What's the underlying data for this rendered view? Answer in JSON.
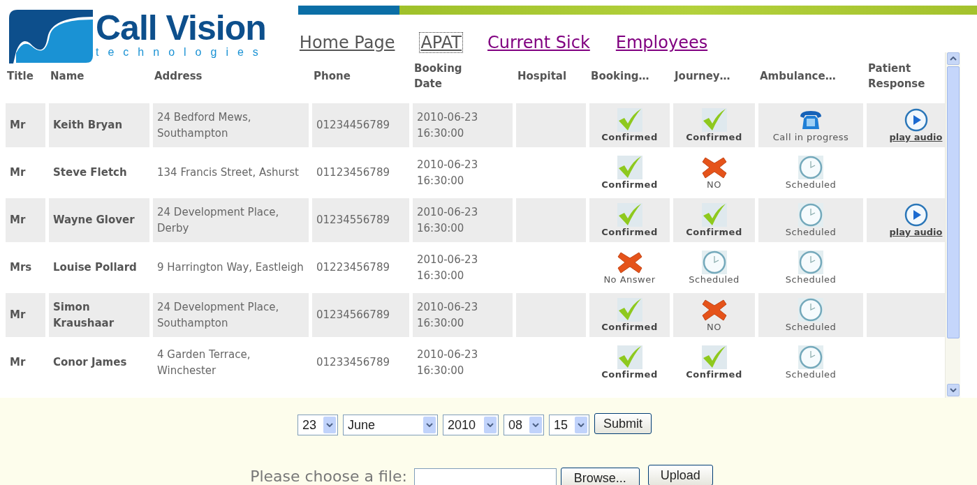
{
  "logo": {
    "name": "Call Vision",
    "tagline": "technologies"
  },
  "nav": [
    {
      "label": "Home Page",
      "visited": false,
      "focused": false
    },
    {
      "label": "APAT",
      "visited": false,
      "focused": true
    },
    {
      "label": "Current Sick",
      "visited": true,
      "focused": false
    },
    {
      "label": "Employees",
      "visited": true,
      "focused": false
    }
  ],
  "table": {
    "columns": [
      "Title",
      "Name",
      "Address",
      "Phone",
      "Booking Date",
      "Hospital",
      "Booking…",
      "Journey…",
      "Ambulance…",
      "Patient Response"
    ],
    "rows": [
      {
        "title": "Mr",
        "name": "Keith Bryan",
        "address": "24 Bedford Mews, Southampton",
        "phone": "01234456789",
        "date": "2010-06-23 16:30:00",
        "booking": {
          "kind": "check",
          "label": "Confirmed"
        },
        "journey": {
          "kind": "check",
          "label": "Confirmed"
        },
        "ambulance": {
          "kind": "phone",
          "label": "Call in progress"
        },
        "response": "play audio"
      },
      {
        "title": "Mr",
        "name": "Steve Fletch",
        "address": "134 Francis Street, Ashurst",
        "phone": "01123456789",
        "date": "2010-06-23 16:30:00",
        "booking": {
          "kind": "check",
          "label": "Confirmed"
        },
        "journey": {
          "kind": "cross",
          "label": "NO"
        },
        "ambulance": {
          "kind": "clock",
          "label": "Scheduled"
        }
      },
      {
        "title": "Mr",
        "name": "Wayne Glover",
        "address": "24 Development Place, Derby",
        "phone": "01234556789",
        "date": "2010-06-23 16:30:00",
        "booking": {
          "kind": "check",
          "label": "Confirmed"
        },
        "journey": {
          "kind": "check",
          "label": "Confirmed"
        },
        "ambulance": {
          "kind": "clock",
          "label": "Scheduled"
        },
        "response": "play audio"
      },
      {
        "title": "Mrs",
        "name": "Louise Pollard",
        "address": "9 Harrington Way, Eastleigh",
        "phone": "01223456789",
        "date": "2010-06-23 16:30:00",
        "booking": {
          "kind": "cross",
          "label": "No Answer"
        },
        "journey": {
          "kind": "clock",
          "label": "Scheduled"
        },
        "ambulance": {
          "kind": "clock",
          "label": "Scheduled"
        }
      },
      {
        "title": "Mr",
        "name": "Simon Kraushaar",
        "address": "24 Development Place, Southampton",
        "phone": "01234566789",
        "date": "2010-06-23 16:30:00",
        "booking": {
          "kind": "check",
          "label": "Confirmed"
        },
        "journey": {
          "kind": "cross",
          "label": "NO"
        },
        "ambulance": {
          "kind": "clock",
          "label": "Scheduled"
        }
      },
      {
        "title": "Mr",
        "name": "Conor James",
        "address": "4 Garden Terrace, Winchester",
        "phone": "01233456789",
        "date": "2010-06-23 16:30:00",
        "booking": {
          "kind": "check",
          "label": "Confirmed"
        },
        "journey": {
          "kind": "check",
          "label": "Confirmed"
        },
        "ambulance": {
          "kind": "clock",
          "label": "Scheduled"
        }
      }
    ]
  },
  "date_form": {
    "selects": [
      {
        "value": "23"
      },
      {
        "value": "June"
      },
      {
        "value": "2010"
      },
      {
        "value": "08"
      },
      {
        "value": "15"
      }
    ],
    "submit": "Submit"
  },
  "upload_form": {
    "label": "Please choose a file:",
    "browse": "Browse...",
    "upload": "Upload"
  }
}
